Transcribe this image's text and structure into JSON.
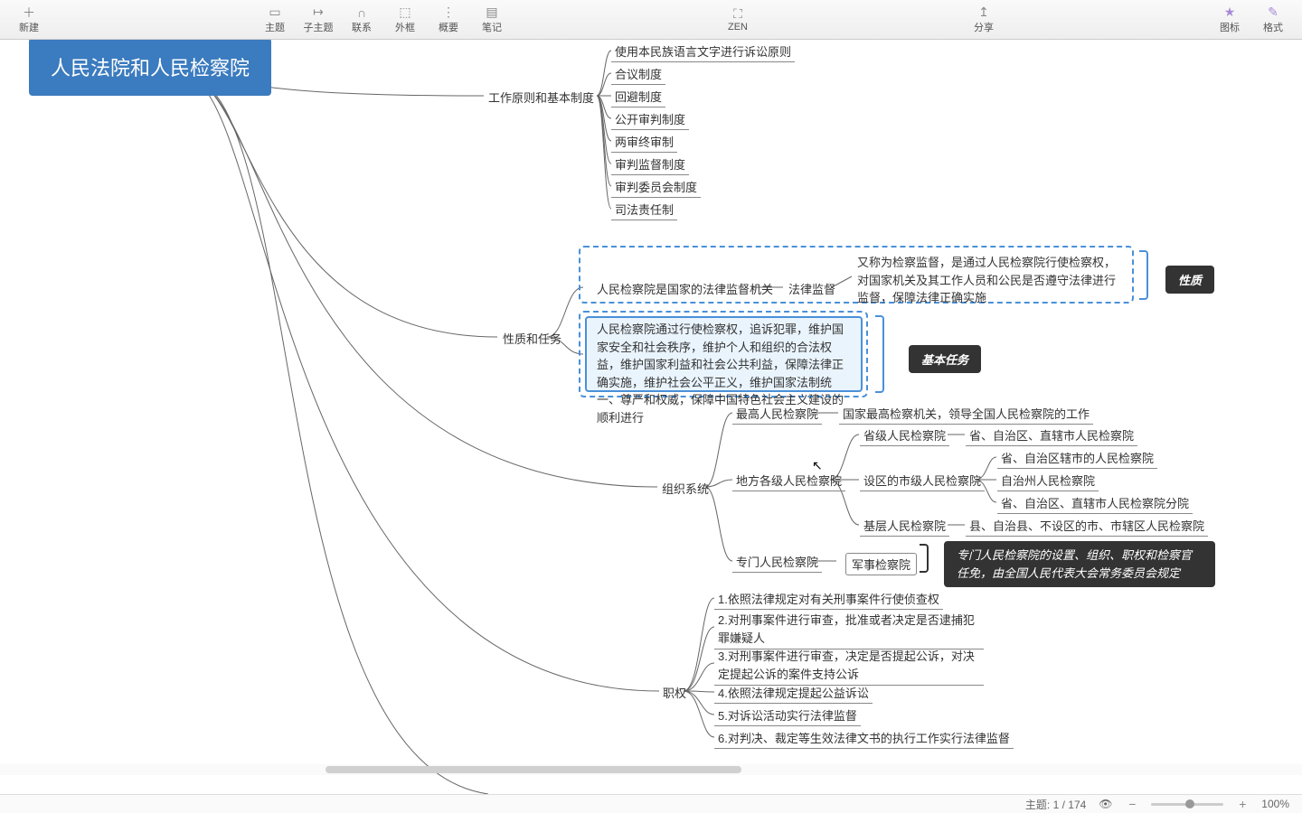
{
  "toolbar": {
    "new": "新建",
    "topic": "主题",
    "subtopic": "子主题",
    "relation": "联系",
    "boundary": "外框",
    "summary": "概要",
    "note": "笔记",
    "zen": "ZEN",
    "share": "分享",
    "stickers": "图标",
    "format": "格式"
  },
  "root": "人民法院和人民检察院",
  "nodes": {
    "work_principles": "工作原则和基本制度",
    "p1": "使用本民族语言文字进行诉讼原则",
    "p2": "合议制度",
    "p3": "回避制度",
    "p4": "公开审判制度",
    "p5": "两审终审制",
    "p6": "审判监督制度",
    "p7": "审判委员会制度",
    "p8": "司法责任制",
    "nature_tasks": "性质和任务",
    "procuratorate_is": "人民检察院是国家的法律监督机关",
    "legal_supervision": "法律监督",
    "legal_supervision_desc": "又称为检察监督，是通过人民检察院行使检察权，对国家机关及其工作人员和公民是否遵守法律进行监督，保障法律正确实施",
    "basic_task_desc": "人民检察院通过行使检察权，追诉犯罪，维护国家安全和社会秩序，维护个人和组织的合法权益，维护国家利益和社会公共利益，保障法律正确实施，维护社会公平正义，维护国家法制统一、尊严和权威，保障中国特色社会主义建设的顺利进行",
    "org_system": "组织系统",
    "supreme_proc": "最高人民检察院",
    "supreme_proc_desc": "国家最高检察机关，领导全国人民检察院的工作",
    "local_proc": "地方各级人民检察院",
    "provincial_proc": "省级人民检察院",
    "provincial_proc_desc": "省、自治区、直辖市人民检察院",
    "district_city_proc": "设区的市级人民检察院",
    "region_city_proc": "省、自治区辖市的人民检察院",
    "auto_prefecture_proc": "自治州人民检察院",
    "branch_proc": "省、自治区、直辖市人民检察院分院",
    "basic_proc": "基层人民检察院",
    "basic_proc_desc": "县、自治县、不设区的市、市辖区人民检察院",
    "special_proc": "专门人民检察院",
    "military_proc": "军事检察院",
    "powers": "职权",
    "power1": "1.依照法律规定对有关刑事案件行使侦查权",
    "power2": "2.对刑事案件进行审查，批准或者决定是否逮捕犯罪嫌疑人",
    "power3": "3.对刑事案件进行审查，决定是否提起公诉，对决定提起公诉的案件支持公诉",
    "power4": "4.依照法律规定提起公益诉讼",
    "power5": "5.对诉讼活动实行法律监督",
    "power6": "6.对判决、裁定等生效法律文书的执行工作实行法律监督"
  },
  "callouts": {
    "nature": "性质",
    "basic_tasks": "基本任务",
    "special_proc_note": "专门人民检察院的设置、组织、职权和检察官任免，由全国人民代表大会常务委员会规定"
  },
  "status": {
    "topics": "主题: 1 / 174",
    "zoom": "100%"
  }
}
